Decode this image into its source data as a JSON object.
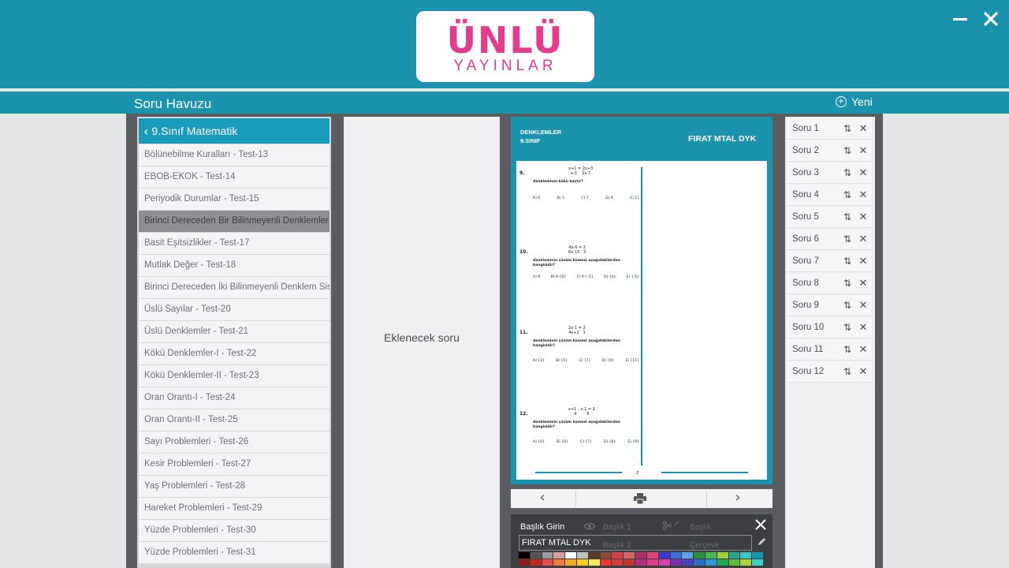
{
  "app": {
    "logo_main": "ÜNLÜ",
    "logo_sub": "YAYINLAR",
    "brand_color": "#e23c8b",
    "accent_color": "#1c93ad",
    "minimize_icon": "minimize-icon",
    "close_icon": "close-icon"
  },
  "header": {
    "title": "Soru Havuzu",
    "new_label": "Yeni"
  },
  "left_panel": {
    "back_label": "9.Sınıf Matematik",
    "items": [
      {
        "label": "Bölünebilme Kuralları - Test-13",
        "active": false
      },
      {
        "label": "EBOB-EKOK - Test-14",
        "active": false
      },
      {
        "label": "Periyodik Durumlar - Test-15",
        "active": false
      },
      {
        "label": "Birinci Dereceden Bir Bilinmeyenli Denklemler",
        "active": true
      },
      {
        "label": "Basit Eşitsizlikler - Test-17",
        "active": false
      },
      {
        "label": "Mutlak Değer - Test-18",
        "active": false
      },
      {
        "label": "Birinci Dereceden İki Bilinmeyenli Denklem Sis",
        "active": false
      },
      {
        "label": "Üslü Sayılar - Test-20",
        "active": false
      },
      {
        "label": "Üslü Denklemler - Test-21",
        "active": false
      },
      {
        "label": "Kökü Denklemler-I - Test-22",
        "active": false
      },
      {
        "label": "Kökü Denklemler-II - Test-23",
        "active": false
      },
      {
        "label": "Oran Orantı-I - Test-24",
        "active": false
      },
      {
        "label": "Oran Orantı-II - Test-25",
        "active": false
      },
      {
        "label": "Sayı Problemleri - Test-26",
        "active": false
      },
      {
        "label": "Kesir Problemleri - Test-27",
        "active": false
      },
      {
        "label": "Yaş Problemleri - Test-28",
        "active": false
      },
      {
        "label": "Hareket Problemleri - Test-29",
        "active": false
      },
      {
        "label": "Yüzde Problemleri - Test-30",
        "active": false
      },
      {
        "label": "Yüzde Problemleri - Test-31",
        "active": false
      }
    ]
  },
  "middle_panel": {
    "placeholder": "Eklenecek soru"
  },
  "preview": {
    "header_left_1": "DENKLEMLER",
    "header_left_2": "9.SINIF",
    "header_right": "FIRAT MTAL DYK",
    "page_number": "2",
    "questions": [
      {
        "num": "9.",
        "frac": "x+1 = 2x+3\nx-3    2x-7",
        "text": "denkleminin kökü kaçtır?",
        "options": [
          "A) 0",
          "B) 5",
          "C) 7",
          "D) 9",
          "E) 11"
        ]
      },
      {
        "num": "10.",
        "frac": "4x-6 = 2\n6x-15   3",
        "text": "denkleminin çözüm kümesi aşağıdakilerden hangisidir?",
        "options": [
          "A) R",
          "B) R-{0}",
          "C) R-{-5}",
          "D) {0}",
          "E) {-5}"
        ]
      },
      {
        "num": "11.",
        "frac": "2x-1 = 2\n4x+2   3",
        "text": "denkleminin çözüm kümesi aşağıdakilerden hangisidir?",
        "options": [
          "A) {3}",
          "B) {5}",
          "C) {7}",
          "D) {9}",
          "E) {11}"
        ]
      },
      {
        "num": "12.",
        "frac": "x+1 - x-1 = 1\n4        6",
        "text": "denkleminin çözüm kümesi aşağıdakilerden hangisidir?",
        "options": [
          "A) {0}",
          "B) {6}",
          "C) {7}",
          "D) {8}",
          "E) {9}"
        ]
      }
    ]
  },
  "nav": {
    "prev_icon": "chevron-left-icon",
    "print_icon": "printer-icon",
    "next_icon": "chevron-right-icon"
  },
  "title_panel": {
    "label": "Başlık Girin",
    "input_value": "FIRAT MTAL DYK",
    "opt1": "Başlık 1",
    "opt2": "Başlık",
    "opt3": "Başlık 2",
    "opt4": "Çerçeve",
    "colors_row1": [
      "#000000",
      "#555555",
      "#999999",
      "#d8a1a1",
      "#ffffff",
      "#c0c0c0",
      "#5a3a2a",
      "#8b4a3a",
      "#c44",
      "#c66",
      "#a36",
      "#d47",
      "#3a3ad0",
      "#3a6fd8",
      "#59a4e8",
      "#2a8f3a",
      "#4bb84b",
      "#9ccf3a",
      "#2aa39a",
      "#39c5c5",
      "#1c93ad"
    ],
    "colors_row2": [
      "#8b1a1a",
      "#c22",
      "#e84a4a",
      "#f07a3a",
      "#f5a623",
      "#f2d21e",
      "#f7ea5a",
      "#e33",
      "#d13c3c",
      "#c3342a",
      "#b72d7a",
      "#e23c8b",
      "#d43fa8",
      "#7a2fb5",
      "#4a3fc1",
      "#2f6ec6",
      "#2b9ad8",
      "#21a85a",
      "#5cbf3a",
      "#aad13a",
      "#3ad1c8"
    ]
  },
  "right_panel": {
    "items": [
      "Soru 1",
      "Soru 2",
      "Soru 3",
      "Soru 4",
      "Soru 5",
      "Soru 6",
      "Soru 7",
      "Soru 8",
      "Soru 9",
      "Soru 10",
      "Soru 11",
      "Soru 12"
    ]
  }
}
